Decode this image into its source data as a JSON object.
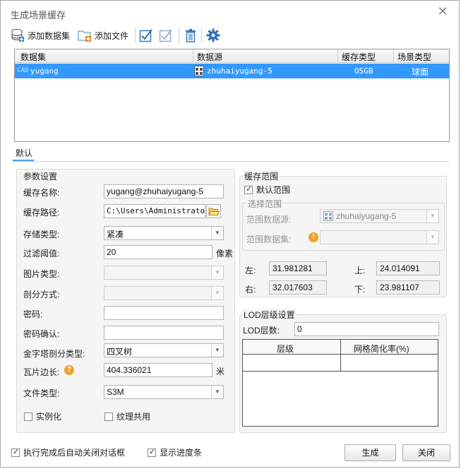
{
  "window": {
    "title": "生成场景缓存"
  },
  "toolbar": {
    "add_dataset_label": "添加数据集",
    "add_file_label": "添加文件"
  },
  "grid": {
    "headers": [
      "数据集",
      "数据源",
      "缓存类型",
      "场景类型"
    ],
    "rows": [
      {
        "dataset": "yugang",
        "datasource": "zhuhaiyugang-5",
        "cache_type": "OSGB",
        "scene_type": "球面",
        "dataset_tag": "CAD"
      }
    ]
  },
  "tabs": [
    "默认"
  ],
  "params": {
    "group_label": "参数设置",
    "cache_name_label": "缓存名称:",
    "cache_name_value": "yugang@zhuhaiyugang-5",
    "cache_path_label": "缓存路径:",
    "cache_path_value": "C:\\Users\\Administrator\\",
    "storage_type_label": "存储类型:",
    "storage_type_value": "紧凑",
    "filter_label": "过滤阈值:",
    "filter_value": "20",
    "filter_unit": "像素",
    "image_type_label": "图片类型:",
    "split_method_label": "剖分方式:",
    "password_label": "密码:",
    "password_confirm_label": "密码确认:",
    "pyramid_label": "金字塔剖分类型:",
    "pyramid_value": "四叉树",
    "tile_side_label": "瓦片边长:",
    "tile_side_value": "404.336021",
    "tile_side_unit": "米",
    "file_type_label": "文件类型:",
    "file_type_value": "S3M",
    "instancing_label": "实例化",
    "texture_share_label": "纹理共用"
  },
  "range": {
    "group_label": "缓存范围",
    "default_range_label": "默认范围",
    "select_range_label": "选择范围",
    "range_datasource_label": "范围数据源:",
    "range_datasource_value": "zhuhaiyugang-5",
    "range_dataset_label": "范围数据集:",
    "left_label": "左:",
    "left_value": "31.981281",
    "top_label": "上:",
    "top_value": "24.014091",
    "right_label": "右:",
    "right_value": "32.017603",
    "bottom_label": "下:",
    "bottom_value": "23.981107"
  },
  "lod": {
    "group_label": "LOD层级设置",
    "count_label": "LOD层数:",
    "count_value": "0",
    "headers": [
      "层级",
      "网格简化率(%)"
    ]
  },
  "footer": {
    "auto_close_label": "执行完成后自动关闭对话框",
    "show_progress_label": "显示进度条",
    "generate_label": "生成",
    "close_label": "关闭"
  },
  "colors": {
    "selection": "#3399ff",
    "accent": "#2a6fb5"
  }
}
